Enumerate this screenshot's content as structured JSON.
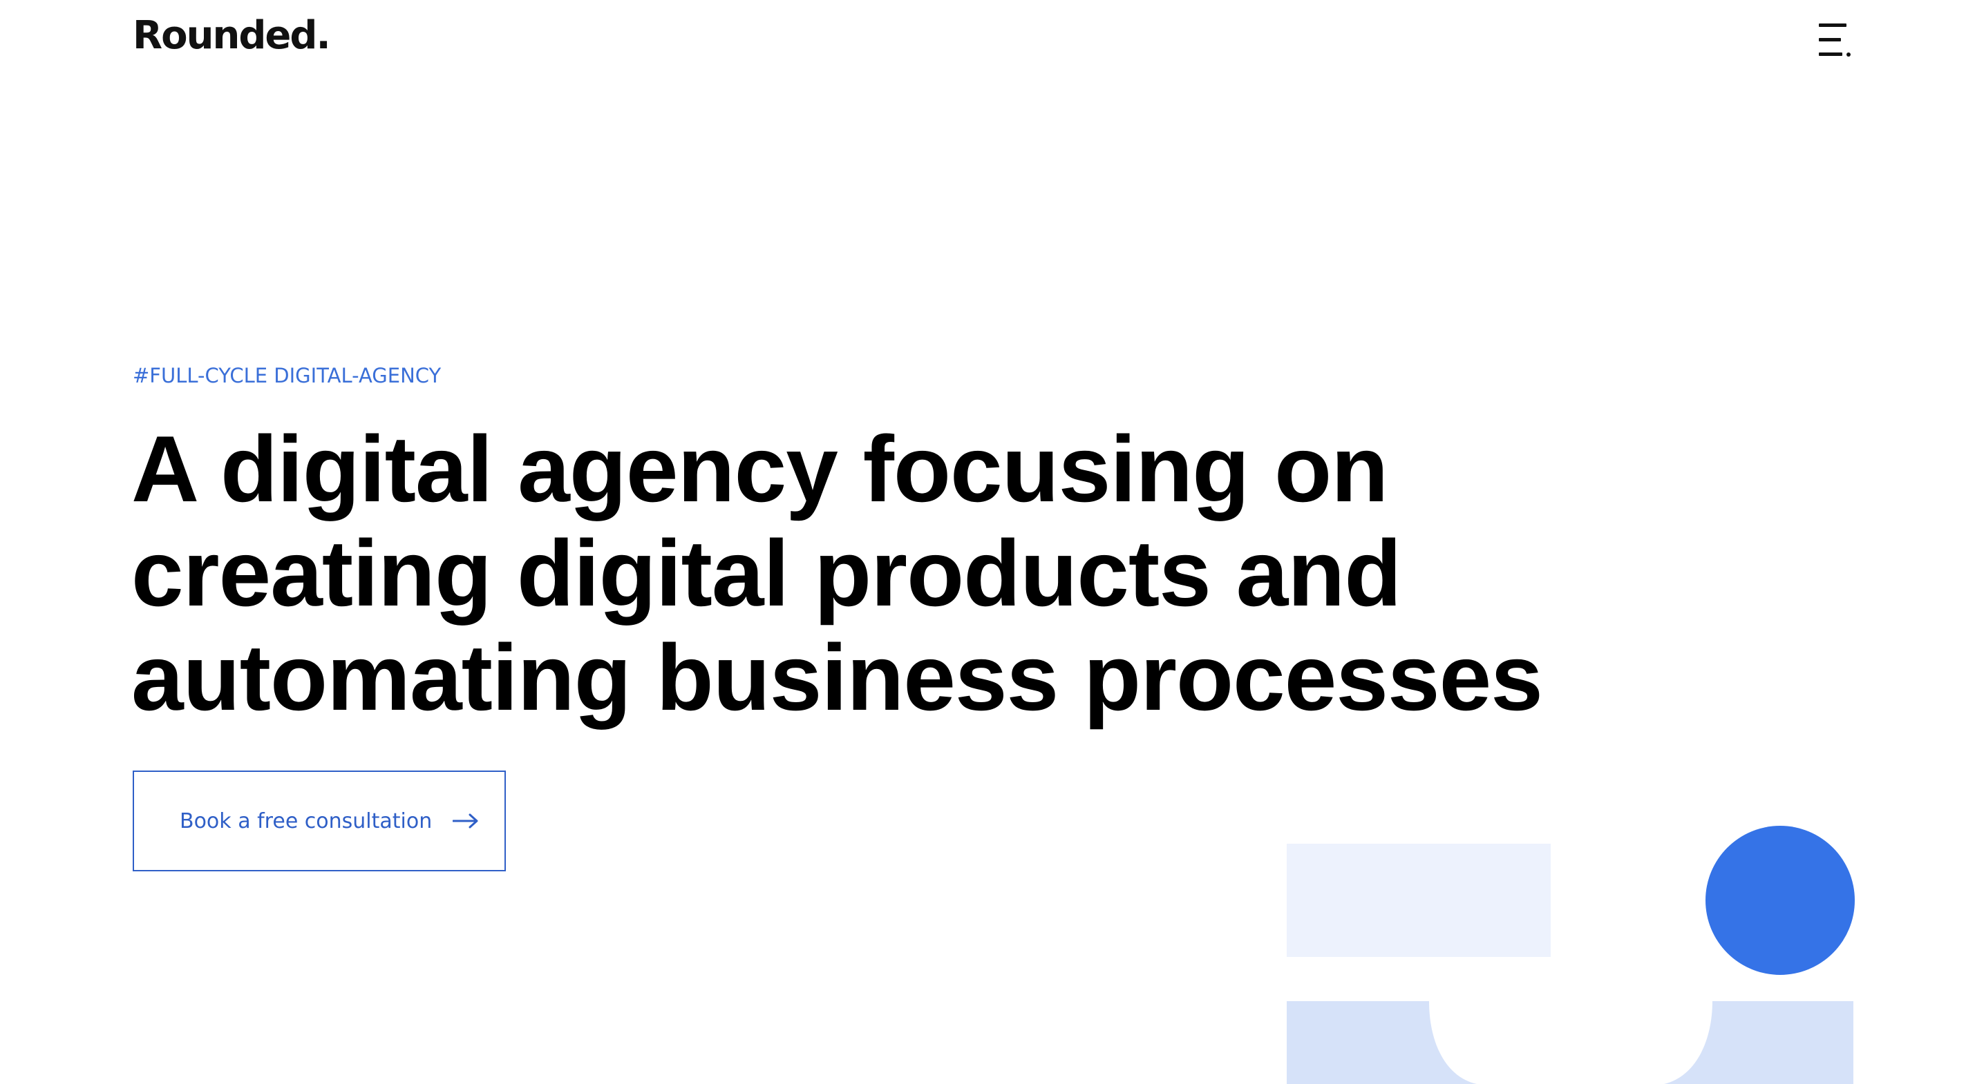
{
  "header": {
    "logo_text": "Rounded.",
    "menu_icon": "hamburger-menu-icon"
  },
  "hero": {
    "tagline": "#FULL-CYCLE DIGITAL-AGENCY",
    "headline_lines": [
      "A digital agency focusing on",
      "creating digital products and",
      "automating business processes"
    ],
    "cta": {
      "label": "Book a free consultation",
      "icon": "arrow-right-icon"
    }
  },
  "colors": {
    "accent": "#3573e7",
    "link_blue": "#2f5fc7",
    "light_blue": "#edf2fd",
    "soft_blue": "#d6e2f9",
    "text": "#000000",
    "background": "#ffffff"
  }
}
